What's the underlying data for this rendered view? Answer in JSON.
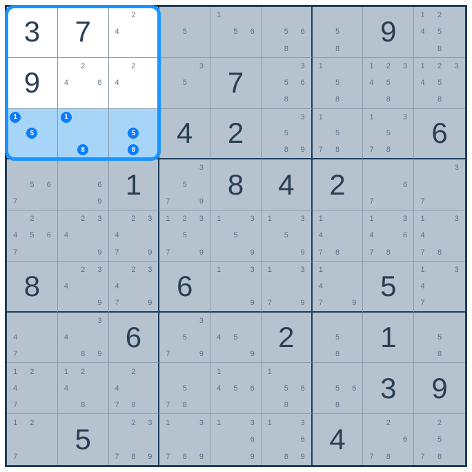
{
  "puzzle": {
    "size": 9,
    "highlight_box": {
      "row_start": 1,
      "row_end": 3,
      "col_start": 1,
      "col_end": 3
    },
    "highlight_row_in_box": 3,
    "cells": [
      [
        {
          "v": "3"
        },
        {
          "v": "7"
        },
        {
          "c": [
            "",
            "2",
            "",
            "4",
            "",
            "",
            "",
            "",
            ""
          ]
        },
        {
          "c": [
            "",
            "",
            "",
            "",
            "5",
            "",
            "",
            "",
            ""
          ]
        },
        {
          "c": [
            "1",
            "",
            "",
            "",
            "5",
            "6",
            "",
            "",
            ""
          ]
        },
        {
          "c": [
            "",
            "",
            "",
            "",
            "5",
            "6",
            "",
            "8",
            ""
          ]
        },
        {
          "c": [
            "",
            "",
            "",
            "",
            "5",
            "",
            "",
            "8",
            ""
          ]
        },
        {
          "v": "9"
        },
        {
          "c": [
            "1",
            "2",
            "",
            "4",
            "5",
            "",
            "",
            "8",
            ""
          ]
        }
      ],
      [
        {
          "v": "9"
        },
        {
          "c": [
            "",
            "2",
            "",
            "4",
            "",
            "6",
            "",
            "",
            ""
          ]
        },
        {
          "c": [
            "",
            "2",
            "",
            "4",
            "",
            "",
            "",
            "",
            ""
          ]
        },
        {
          "c": [
            "",
            "",
            "3",
            "",
            "5",
            "",
            "",
            "",
            ""
          ]
        },
        {
          "v": "7"
        },
        {
          "c": [
            "",
            "",
            "3",
            "",
            "5",
            "6",
            "",
            "8",
            ""
          ]
        },
        {
          "c": [
            "1",
            "",
            "",
            "",
            "5",
            "",
            "",
            "8",
            ""
          ]
        },
        {
          "c": [
            "1",
            "2",
            "3",
            "4",
            "5",
            "",
            "",
            "8",
            ""
          ]
        },
        {
          "c": [
            "1",
            "2",
            "3",
            "4",
            "5",
            "",
            "",
            "8",
            ""
          ]
        }
      ],
      [
        {
          "c": [
            "",
            "",
            "",
            "",
            "",
            "",
            "",
            "",
            ""
          ],
          "hc": {
            "1": true,
            "5": true
          }
        },
        {
          "c": [
            "",
            "",
            "",
            "",
            "",
            "",
            "",
            "",
            ""
          ],
          "hc": {
            "1": true,
            "8": true
          }
        },
        {
          "c": [
            "",
            "",
            "",
            "",
            "",
            "",
            "",
            "",
            ""
          ],
          "hc": {
            "5": true,
            "8": true
          }
        },
        {
          "v": "4"
        },
        {
          "v": "2"
        },
        {
          "c": [
            "",
            "",
            "3",
            "",
            "5",
            "",
            "",
            "8",
            "9"
          ]
        },
        {
          "c": [
            "1",
            "",
            "",
            "",
            "5",
            "",
            "7",
            "8",
            ""
          ]
        },
        {
          "c": [
            "1",
            "",
            "3",
            "",
            "5",
            "",
            "7",
            "8",
            ""
          ]
        },
        {
          "v": "6"
        }
      ],
      [
        {
          "c": [
            "",
            "",
            "",
            "",
            "5",
            "6",
            "7",
            "",
            ""
          ]
        },
        {
          "c": [
            "",
            "",
            "",
            "",
            "",
            "6",
            "",
            "",
            "9"
          ]
        },
        {
          "v": "1"
        },
        {
          "c": [
            "",
            "",
            "3",
            "",
            "5",
            "",
            "7",
            "",
            "9"
          ]
        },
        {
          "v": "8"
        },
        {
          "v": "4"
        },
        {
          "v": "2"
        },
        {
          "c": [
            "",
            "",
            "",
            "",
            "",
            "6",
            "7",
            "",
            ""
          ]
        },
        {
          "c": [
            "",
            "",
            "3",
            "",
            "",
            "",
            "7",
            "",
            ""
          ]
        }
      ],
      [
        {
          "c": [
            "",
            "2",
            "",
            "4",
            "5",
            "6",
            "7",
            "",
            ""
          ]
        },
        {
          "c": [
            "",
            "2",
            "3",
            "4",
            "",
            "",
            "",
            "",
            "9"
          ]
        },
        {
          "c": [
            "",
            "2",
            "3",
            "4",
            "",
            "",
            "7",
            "",
            "9"
          ]
        },
        {
          "c": [
            "1",
            "2",
            "3",
            "",
            "5",
            "",
            "7",
            "",
            "9"
          ]
        },
        {
          "c": [
            "1",
            "",
            "3",
            "",
            "5",
            "",
            "",
            "",
            "9"
          ]
        },
        {
          "c": [
            "1",
            "",
            "3",
            "",
            "5",
            "",
            "",
            "",
            "9"
          ]
        },
        {
          "c": [
            "1",
            "",
            "",
            "4",
            "",
            "",
            "7",
            "8",
            ""
          ]
        },
        {
          "c": [
            "1",
            "",
            "3",
            "4",
            "",
            "6",
            "7",
            "8",
            ""
          ]
        },
        {
          "c": [
            "1",
            "",
            "3",
            "4",
            "",
            "",
            "7",
            "8",
            ""
          ]
        }
      ],
      [
        {
          "v": "8"
        },
        {
          "c": [
            "",
            "2",
            "3",
            "4",
            "",
            "",
            "",
            "",
            "9"
          ]
        },
        {
          "c": [
            "",
            "2",
            "3",
            "4",
            "",
            "",
            "7",
            "",
            "9"
          ]
        },
        {
          "v": "6"
        },
        {
          "c": [
            "1",
            "",
            "3",
            "",
            "",
            "",
            "",
            "",
            "9"
          ]
        },
        {
          "c": [
            "1",
            "",
            "3",
            "",
            "",
            "",
            "7",
            "",
            "9"
          ]
        },
        {
          "c": [
            "1",
            "",
            "",
            "4",
            "",
            "",
            "7",
            "",
            "9"
          ]
        },
        {
          "v": "5"
        },
        {
          "c": [
            "1",
            "",
            "3",
            "4",
            "",
            "",
            "7",
            "",
            ""
          ]
        }
      ],
      [
        {
          "c": [
            "",
            "",
            "",
            "4",
            "",
            "",
            "7",
            "",
            ""
          ]
        },
        {
          "c": [
            "",
            "",
            "3",
            "4",
            "",
            "",
            "",
            "8",
            "9"
          ]
        },
        {
          "v": "6"
        },
        {
          "c": [
            "",
            "",
            "3",
            "",
            "5",
            "",
            "7",
            "",
            "9"
          ]
        },
        {
          "c": [
            "",
            "",
            "",
            "4",
            "5",
            "",
            "",
            "",
            "9"
          ]
        },
        {
          "v": "2"
        },
        {
          "c": [
            "",
            "",
            "",
            "",
            "5",
            "",
            "",
            "8",
            ""
          ]
        },
        {
          "v": "1"
        },
        {
          "c": [
            "",
            "",
            "",
            "",
            "5",
            "",
            "",
            "8",
            ""
          ]
        }
      ],
      [
        {
          "c": [
            "1",
            "2",
            "",
            "4",
            "",
            "",
            "7",
            "",
            ""
          ]
        },
        {
          "c": [
            "1",
            "2",
            "",
            "4",
            "",
            "",
            "",
            "8",
            ""
          ]
        },
        {
          "c": [
            "",
            "2",
            "",
            "4",
            "",
            "",
            "7",
            "8",
            ""
          ]
        },
        {
          "c": [
            "",
            "",
            "",
            "",
            "5",
            "",
            "7",
            "8",
            ""
          ]
        },
        {
          "c": [
            "1",
            "",
            "",
            "4",
            "5",
            "6",
            "",
            "",
            ""
          ]
        },
        {
          "c": [
            "1",
            "",
            "",
            "",
            "5",
            "6",
            "",
            "8",
            ""
          ]
        },
        {
          "c": [
            "",
            "",
            "",
            "",
            "5",
            "6",
            "",
            "8",
            ""
          ]
        },
        {
          "v": "3"
        },
        {
          "v": "9"
        }
      ],
      [
        {
          "c": [
            "1",
            "2",
            "",
            "",
            "",
            "",
            "7",
            "",
            ""
          ]
        },
        {
          "v": "5"
        },
        {
          "c": [
            "",
            "2",
            "3",
            "",
            "",
            "",
            "7",
            "8",
            "9"
          ]
        },
        {
          "c": [
            "1",
            "",
            "3",
            "",
            "",
            "",
            "7",
            "8",
            "9"
          ]
        },
        {
          "c": [
            "1",
            "",
            "3",
            "",
            "",
            "6",
            "",
            "",
            "9"
          ]
        },
        {
          "c": [
            "1",
            "",
            "3",
            "",
            "",
            "6",
            "",
            "8",
            "9"
          ]
        },
        {
          "v": "4"
        },
        {
          "c": [
            "",
            "2",
            "",
            "",
            "",
            "6",
            "7",
            "8",
            ""
          ]
        },
        {
          "c": [
            "",
            "2",
            "",
            "",
            "5",
            "",
            "7",
            "8",
            ""
          ]
        }
      ]
    ]
  }
}
